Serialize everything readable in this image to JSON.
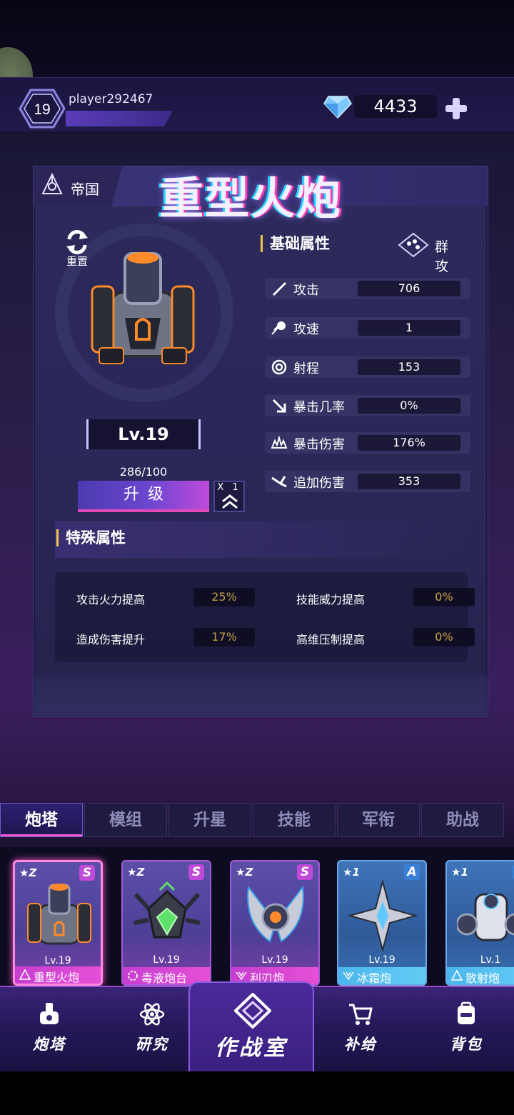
{
  "header": {
    "level": "19",
    "player_name": "player292467",
    "gem_count": "4433"
  },
  "turret": {
    "faction": "帝国",
    "name": "重型火炮",
    "reset_label": "重置",
    "level": "Lv.19",
    "exp": "286/100",
    "upgrade_label": "升级",
    "multiplier": "X 1"
  },
  "base_attributes": {
    "title": "基础属性",
    "attack_type": "群 攻",
    "stats": [
      {
        "label": "攻击",
        "value": "706",
        "icon": "sword-icon"
      },
      {
        "label": "攻速",
        "value": "1",
        "icon": "speed-icon"
      },
      {
        "label": "射程",
        "value": "153",
        "icon": "range-icon"
      },
      {
        "label": "暴击几率",
        "value": "0%",
        "icon": "crit-rate-icon"
      },
      {
        "label": "暴击伤害",
        "value": "176%",
        "icon": "crit-damage-icon"
      },
      {
        "label": "追加伤害",
        "value": "353",
        "icon": "extra-damage-icon"
      }
    ]
  },
  "special_attributes": {
    "title": "特殊属性",
    "items": [
      {
        "label": "攻击火力提高",
        "value": "25%"
      },
      {
        "label": "技能威力提高",
        "value": "0%"
      },
      {
        "label": "造成伤害提升",
        "value": "17%"
      },
      {
        "label": "高维压制提高",
        "value": "0%"
      }
    ]
  },
  "tabs": [
    {
      "label": "炮塔",
      "active": true
    },
    {
      "label": "模组",
      "active": false
    },
    {
      "label": "升星",
      "active": false
    },
    {
      "label": "技能",
      "active": false
    },
    {
      "label": "军衔",
      "active": false
    },
    {
      "label": "助战",
      "active": false
    }
  ],
  "cards": [
    {
      "star": "★Z",
      "rank": "S",
      "level": "Lv.19",
      "name": "重型火炮",
      "selected": true
    },
    {
      "star": "★Z",
      "rank": "S",
      "level": "Lv.19",
      "name": "毒液炮台",
      "selected": false
    },
    {
      "star": "★Z",
      "rank": "S",
      "level": "Lv.19",
      "name": "利刃炮",
      "selected": false
    },
    {
      "star": "★1",
      "rank": "A",
      "level": "Lv.19",
      "name": "冰霜炮",
      "selected": false
    },
    {
      "star": "★1",
      "rank": "A",
      "level": "Lv.1",
      "name": "散射炮",
      "selected": false
    }
  ],
  "bottom_nav": [
    {
      "label": "炮塔",
      "icon": "turret-icon"
    },
    {
      "label": "研究",
      "icon": "atom-icon"
    },
    {
      "label": "作战室",
      "icon": "war-room-icon"
    },
    {
      "label": "补给",
      "icon": "cart-icon"
    },
    {
      "label": "背包",
      "icon": "backpack-icon"
    }
  ],
  "colors": {
    "accent_pink": "#f05bd0",
    "accent_gold": "#f2c54a",
    "rank_s": "#c04ad8",
    "rank_a": "#3a80d8"
  }
}
